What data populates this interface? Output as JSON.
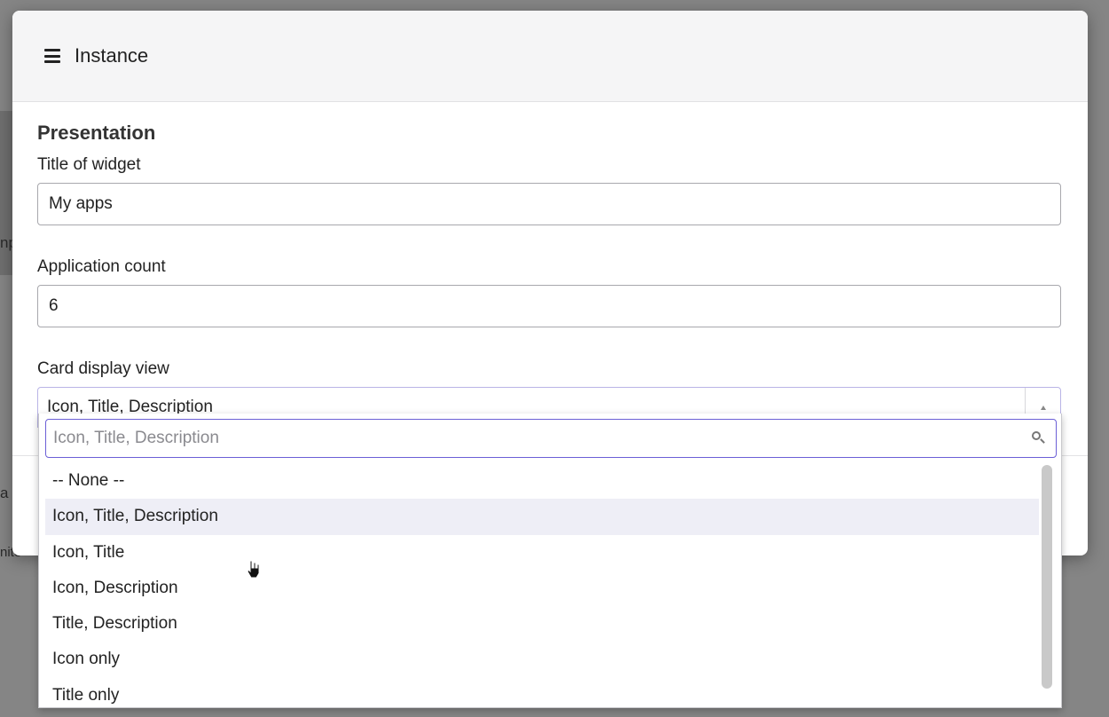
{
  "modal": {
    "title": "Instance",
    "section_title": "Presentation"
  },
  "fields": {
    "title_label": "Title of widget",
    "title_value": "My apps",
    "count_label": "Application count",
    "count_value": "6",
    "card_label": "Card display view",
    "card_value": "Icon, Title, Description"
  },
  "dropdown": {
    "search_placeholder": "Icon, Title, Description",
    "options": [
      "-- None --",
      "Icon, Title, Description",
      "Icon, Title",
      "Icon, Description",
      "Title, Description",
      "Icon only",
      "Title only"
    ],
    "highlighted_index": 1
  },
  "background": {
    "fragments": [
      "np",
      "a",
      "nite"
    ]
  },
  "colors": {
    "overlay": "#858585",
    "focus_border": "#6b5fd6",
    "highlight": "#eeeef6"
  }
}
